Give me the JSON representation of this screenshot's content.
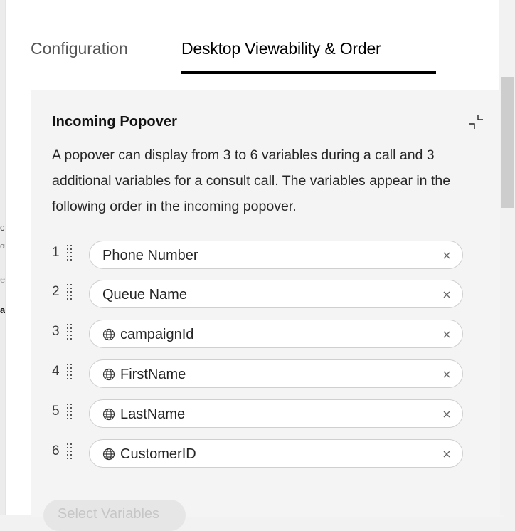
{
  "background": {
    "fragments": [
      "c",
      "ou",
      "e",
      "al"
    ]
  },
  "tabs": {
    "configuration": "Configuration",
    "desktop_viewability": "Desktop Viewability & Order",
    "active": "desktop_viewability"
  },
  "card": {
    "title": "Incoming Popover",
    "collapse_icon": "collapse-icon",
    "description": "A popover can display from 3 to 6 variables during a call and 3 additional variables for a consult call. The variables appear in the following order in the incoming popover.",
    "variables": [
      {
        "position": "1",
        "label": "Phone Number",
        "global": false
      },
      {
        "position": "2",
        "label": "Queue Name",
        "global": false
      },
      {
        "position": "3",
        "label": "campaignId",
        "global": true
      },
      {
        "position": "4",
        "label": "FirstName",
        "global": true
      },
      {
        "position": "5",
        "label": "LastName",
        "global": true
      },
      {
        "position": "6",
        "label": "CustomerID",
        "global": true
      }
    ],
    "select_button": "Select Variables"
  },
  "colors": {
    "accent": "#000000",
    "card_bg": "#f4f4f4",
    "pill_border": "#cfcfcf",
    "disabled_text": "#c6c6c6"
  }
}
